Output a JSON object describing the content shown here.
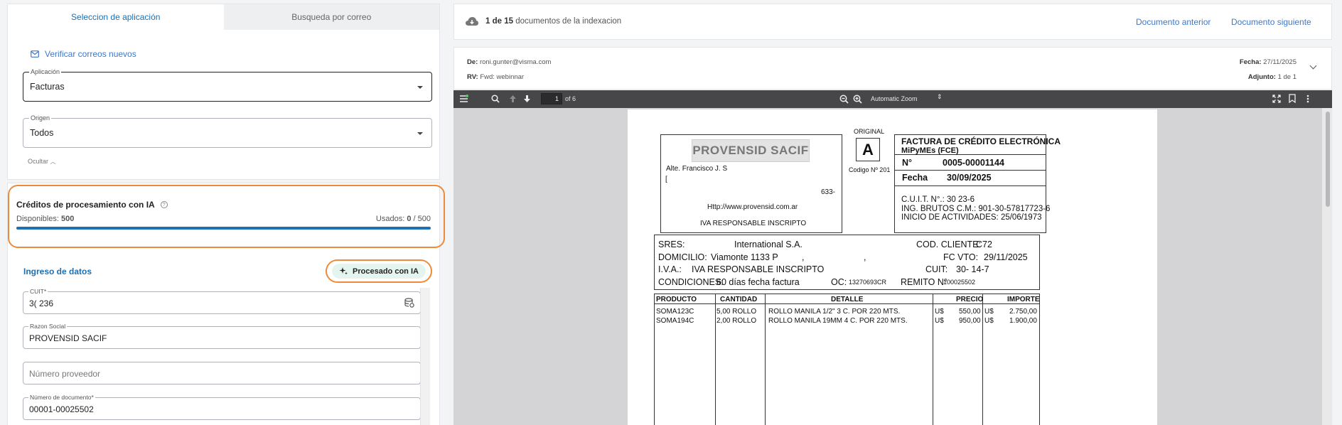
{
  "tabs": [
    "Seleccion de aplicación",
    "Busqueda por correo"
  ],
  "verify_label": "Verificar correos nuevos",
  "aplicacion": {
    "label": "Aplicación",
    "value": "Facturas"
  },
  "origen": {
    "label": "Origen",
    "value": "Todos"
  },
  "ocultar": "Ocultar",
  "credits": {
    "title": "Créditos de procesamiento con IA",
    "disponibles_label": "Disponibles:",
    "disponibles": "500",
    "usados_label": "Usados:",
    "usados": "0",
    "total": "/ 500",
    "used_fraction": 0
  },
  "ingreso": {
    "title": "Ingreso de datos",
    "ia_label": "Procesado con IA"
  },
  "fields": {
    "cuit": {
      "label": "CUIT*",
      "value": "3(          236"
    },
    "razon": {
      "label": "Razon Social",
      "value": "PROVENSID SACIF"
    },
    "proveedor": {
      "placeholder": "Número proveedor"
    },
    "documento": {
      "label": "Número de documento*",
      "value": "00001-00025502"
    }
  },
  "nav": {
    "position": "1 de 15",
    "suffix": "documentos de la indexacion",
    "prev": "Documento anterior",
    "next": "Documento siguiente"
  },
  "mail": {
    "de_label": "De:",
    "de": "roni.gunter@visma.com",
    "rv_label": "RV:",
    "rv": "Fwd: webinnar",
    "fecha_label": "Fecha:",
    "fecha": "27/11/2025",
    "adjunto_label": "Adjunto:",
    "adjunto": "1 de 1"
  },
  "viewer": {
    "page": "1",
    "of": "of 6",
    "zoom": "Automatic Zoom"
  },
  "invoice": {
    "logo": "PROVENSID SACIF",
    "address1": "Alte. Francisco J. S",
    "address2": "[",
    "address3": "633-",
    "web": "Http://www.provensid.com.ar",
    "iva_emisor": "IVA RESPONSABLE INSCRIPTO",
    "original": "ORIGINAL",
    "letter": "A",
    "codigo": "Codigo Nº 201",
    "title1": "FACTURA DE CRÉDITO ELECTRÓNICA",
    "title2": "MiPyMEs (FCE)",
    "nro_label": "N°",
    "nro": "0005-00001144",
    "fecha_label": "Fecha",
    "fecha": "30/09/2025",
    "cuit_line": "C.U.I.T.  N°.: 30          23-6",
    "ib_line": "ING. BRUTOS C.M.:  901-30-57817723-6",
    "inicio_line": "INICIO DE ACTIVIDADES: 25/06/1973",
    "sres_label": "SRES:",
    "sres": "International S.A.",
    "codcli_label": "COD. CLIENTE:",
    "codcli": "C72",
    "dom_label": "DOMICILIO:",
    "dom": "Viamonte 1133 P",
    "dom_c1": ",",
    "dom_c2": ",",
    "fcvto_label": "FC VTO:",
    "fcvto": "29/11/2025",
    "iva_label": "I.V.A.:",
    "iva": "IVA RESPONSABLE INSCRIPTO",
    "cuit2_label": "CUIT:",
    "cuit2": "30-          14-7",
    "cond_label": "CONDICIONES:",
    "cond": "60 días fecha factura",
    "oc_label": "OC:",
    "oc": "13270693CR",
    "remito_label": "REMITO N°",
    "remito": "100025502",
    "columns": [
      "PRODUCTO",
      "CANTIDAD",
      "DETALLE",
      "PRECIO",
      "IMPORTE"
    ],
    "rows": [
      {
        "producto": "SOMA123C",
        "cantidad": "5,00 ROLLO",
        "detalle": "ROLLO MANILA 1/2\"  3 C. POR  220 MTS.",
        "cur1": "U$",
        "precio": "550,00",
        "cur2": "U$",
        "importe": "2.750,00"
      },
      {
        "producto": "SOMA194C",
        "cantidad": "2,00 ROLLO",
        "detalle": "ROLLO MANILA 19MM 4 C. POR  220 MTS.",
        "cur1": "U$",
        "precio": "950,00",
        "cur2": "U$",
        "importe": "1.900,00"
      }
    ]
  },
  "colors": {
    "accent": "#1e6fb0",
    "link": "#3e78c8",
    "highlight": "#ee8b3a",
    "ia_bg": "#e4f5ef"
  }
}
